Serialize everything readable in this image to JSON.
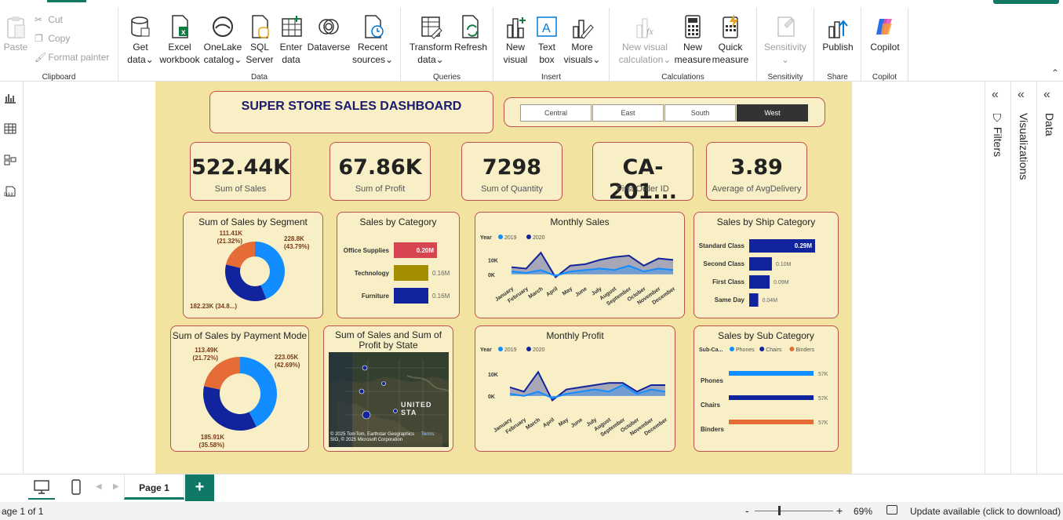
{
  "ribbon": {
    "clipboard": {
      "label": "Clipboard",
      "paste": "Paste",
      "cut": "Cut",
      "copy": "Copy",
      "format_painter": "Format painter"
    },
    "data": {
      "label": "Data",
      "get_data": [
        "Get",
        "data"
      ],
      "excel": [
        "Excel",
        "workbook"
      ],
      "onelake": [
        "OneLake",
        "catalog"
      ],
      "sql": [
        "SQL",
        "Server"
      ],
      "enter": [
        "Enter",
        "data"
      ],
      "dataverse": "Dataverse",
      "recent": [
        "Recent",
        "sources"
      ]
    },
    "queries": {
      "label": "Queries",
      "transform": [
        "Transform",
        "data"
      ],
      "refresh": "Refresh"
    },
    "insert": {
      "label": "Insert",
      "new_visual": [
        "New",
        "visual"
      ],
      "text_box": [
        "Text",
        "box"
      ],
      "more": [
        "More",
        "visuals"
      ]
    },
    "calculations": {
      "label": "Calculations",
      "new_visual_calc": [
        "New visual",
        "calculation"
      ],
      "new_measure": [
        "New",
        "measure"
      ],
      "quick_measure": [
        "Quick",
        "measure"
      ]
    },
    "sensitivity": {
      "label": "Sensitivity",
      "btn": "Sensitivity"
    },
    "share": {
      "label": "Share",
      "publish": "Publish"
    },
    "copilot": {
      "label": "Copilot",
      "btn": "Copilot"
    }
  },
  "dashboard": {
    "title": "SUPER STORE SALES DASHBOARD",
    "regions": [
      "Central",
      "East",
      "South",
      "West"
    ],
    "selected_region": "West",
    "kpis": [
      {
        "value": "522.44K",
        "label": "Sum of Sales"
      },
      {
        "value": "67.86K",
        "label": "Sum of Profit"
      },
      {
        "value": "7298",
        "label": "Sum of Quantity"
      },
      {
        "value": "CA-201...",
        "label": "First Order ID"
      },
      {
        "value": "3.89",
        "label": "Average of AvgDelivery"
      }
    ]
  },
  "chart_data": [
    {
      "type": "pie",
      "title": "Sum of Sales by Segment",
      "slices": [
        {
          "value": 228.8,
          "label": "228.8K",
          "pct": "(43.79%)",
          "color": "#118dff"
        },
        {
          "value": 182.23,
          "label": "182.23K (34.8...)",
          "pct": "",
          "color": "#12239e"
        },
        {
          "value": 111.41,
          "label": "111.41K",
          "pct": "(21.32%)",
          "color": "#e66c37"
        }
      ]
    },
    {
      "type": "bar",
      "title": "Sales by Category",
      "categories": [
        "Office Supplies",
        "Technology",
        "Furniture"
      ],
      "values": [
        0.2,
        0.16,
        0.16
      ],
      "labels": [
        "0.20M",
        "0.16M",
        "0.16M"
      ],
      "colors": [
        "#d64550",
        "#a58d00",
        "#12239e"
      ]
    },
    {
      "type": "area",
      "title": "Monthly Sales",
      "legend_title": "Year",
      "categories": [
        "January",
        "February",
        "March",
        "April",
        "May",
        "June",
        "July",
        "August",
        "September",
        "October",
        "November",
        "December"
      ],
      "series": [
        {
          "name": "2019",
          "color": "#118dff",
          "values": [
            2,
            1,
            3,
            -1,
            2,
            3,
            4,
            3,
            6,
            2,
            4,
            3
          ]
        },
        {
          "name": "2020",
          "color": "#12239e",
          "values": [
            5,
            4,
            15,
            -2,
            6,
            7,
            10,
            12,
            13,
            6,
            11,
            10
          ]
        }
      ],
      "yticks": [
        "10K",
        "0K"
      ],
      "ylim": [
        -5,
        20
      ]
    },
    {
      "type": "bar",
      "title": "Sales by Ship Category",
      "categories": [
        "Standard Class",
        "Second Class",
        "First Class",
        "Same Day"
      ],
      "values": [
        0.29,
        0.1,
        0.09,
        0.04
      ],
      "labels": [
        "0.29M",
        "0.10M",
        "0.09M",
        "0.04M"
      ],
      "color": "#12239e"
    },
    {
      "type": "pie",
      "title": "Sum of Sales by Payment Mode",
      "slices": [
        {
          "value": 223.05,
          "label": "223.05K",
          "pct": "(42.69%)",
          "color": "#118dff"
        },
        {
          "value": 185.91,
          "label": "185.91K",
          "pct": "(35.58%)",
          "color": "#12239e"
        },
        {
          "value": 113.49,
          "label": "113.49K",
          "pct": "(21.72%)",
          "color": "#e66c37"
        }
      ]
    },
    {
      "type": "area",
      "title": "Monthly Profit",
      "legend_title": "Year",
      "categories": [
        "January",
        "February",
        "March",
        "April",
        "May",
        "June",
        "July",
        "August",
        "September",
        "October",
        "November",
        "December"
      ],
      "series": [
        {
          "name": "2019",
          "color": "#118dff",
          "values": [
            1,
            0,
            2,
            -1,
            1,
            2,
            3,
            2,
            5,
            1,
            3,
            2
          ]
        },
        {
          "name": "2020",
          "color": "#12239e",
          "values": [
            4,
            2,
            11,
            -2,
            3,
            4,
            5,
            6,
            6,
            2,
            5,
            5
          ]
        }
      ],
      "yticks": [
        "10K",
        "0K"
      ],
      "ylim": [
        -4,
        14
      ]
    },
    {
      "type": "bar",
      "title": "Sales by Sub Category",
      "legend_title": "Sub-Ca...",
      "legend": [
        "Phones",
        "Chairs",
        "Binders"
      ],
      "categories": [
        "Phones",
        "Chairs",
        "Binders"
      ],
      "values": [
        57,
        57,
        57
      ],
      "labels": [
        "57K",
        "57K",
        "57K"
      ],
      "colors": [
        "#118dff",
        "#12239e",
        "#e66c37"
      ]
    }
  ],
  "map": {
    "title": [
      "Sum of Sales and Sum of",
      "Profit by State"
    ],
    "country_label": "UNITED STA",
    "attribution": [
      "© 2025 TomTom, Earthstar Geographics",
      "SIO, © 2025 Microsoft Corporation"
    ],
    "terms": "Terms"
  },
  "panes": {
    "filters": "Filters",
    "visualizations": "Visualizations",
    "data": "Data"
  },
  "tabs": {
    "page1": "Page 1",
    "add": "+"
  },
  "status": {
    "page_info": "age 1 of 1",
    "zoom": "69%",
    "update": "Update available (click to download)",
    "minus": "-",
    "plus": "+"
  }
}
